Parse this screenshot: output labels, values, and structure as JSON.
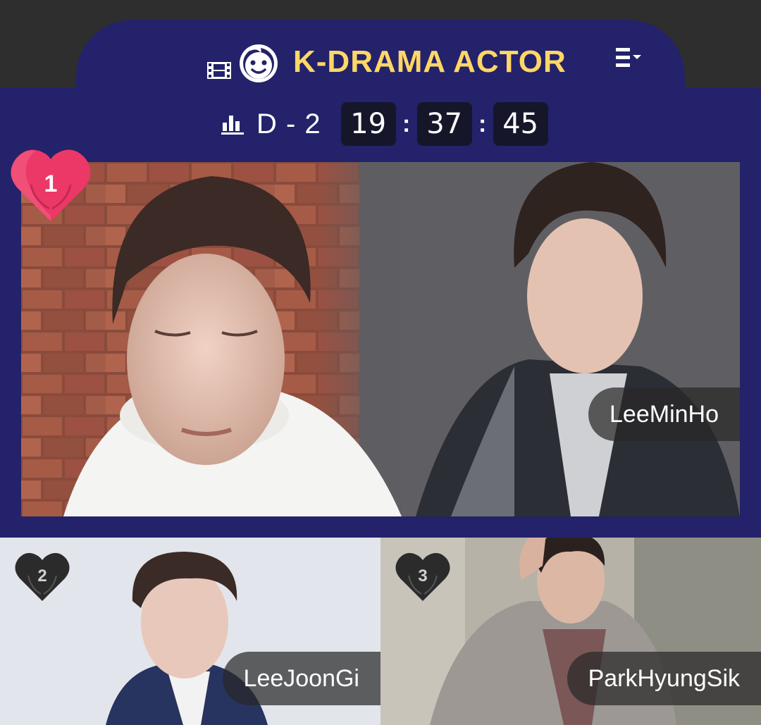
{
  "header": {
    "title": "K-DRAMA ACTOR",
    "icons": [
      "film-icon",
      "baby-face-icon",
      "menu-dropdown-icon"
    ]
  },
  "timer": {
    "icon": "bar-chart-icon",
    "dday": "D - 2",
    "hours": "19",
    "minutes": "37",
    "seconds": "45",
    "separator": ":"
  },
  "ranking": [
    {
      "rank": "1",
      "name": "LeeMinHo"
    },
    {
      "rank": "2",
      "name": "LeeJoonGi"
    },
    {
      "rank": "3",
      "name": "ParkHyungSik"
    }
  ],
  "colors": {
    "background": "#23226a",
    "topbar": "#2e2e2e",
    "title": "#ffd766",
    "rank1_heart": "#ec3867",
    "rank_other_heart": "#2b2b2b"
  }
}
